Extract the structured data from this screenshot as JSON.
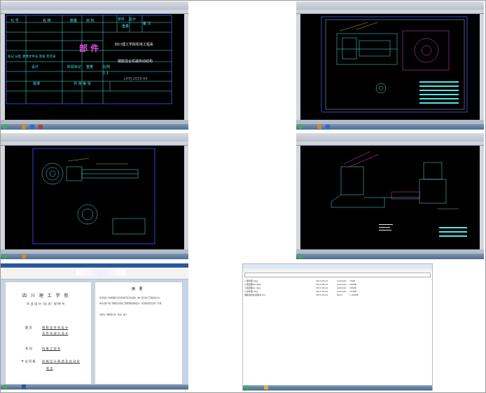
{
  "shot1": {
    "table_cells": {
      "code": "代  号",
      "name": "名  称",
      "quantity": "数量",
      "material": "材  料",
      "unit_weight": "单件",
      "total": "总计",
      "weight": "重量",
      "remark": "备  注",
      "big_title": "部  件",
      "school": "四川理工学院机电工程系",
      "drawing": "钢筋混合机械传动结构",
      "number": "LHPJ-2033-04",
      "mark": "阶段标记",
      "weight2": "重量",
      "scale": "比例",
      "scale_val": "1:1",
      "sheets": "共  张  第  张",
      "check": "批准",
      "zone": "标记  分区  更改文件号  签名  年月日",
      "design": "设计"
    }
  },
  "shot5": {
    "title": "四 川 理 工 学 院",
    "subtitle": "毕 业 设 计（论 文）说 明 书",
    "field_topic_label": "题  目",
    "field_topic_value": "钢 筋 混 合 机 设 计",
    "field_topic_value2": "及 传 动 部 分 设 计",
    "field_dept_label": "系  别",
    "field_dept_value": "机 电 工 程 系",
    "field_major_label": "专 业 班 级",
    "field_major_value": "机 械 设 计 制 造 及 自 动 化",
    "field_student": "姓 名",
    "abstract_title": "摘  要",
    "abstract_line1": "混合机是一种将钢筋与混合料进行混合的设备，被广泛应用于工程建设之中。",
    "abstract_line2": "本文主要介绍了钢筋混合机的工作原理和结构设计，对其传动部分进行了计算。",
    "abstract_line3": "关键词：钢筋混合机；传动；设计"
  },
  "shot6": {
    "files": [
      {
        "name": "1.部件图.dwg",
        "date": "2013-05-21",
        "type": "AutoCAD",
        "size": "75KB"
      },
      {
        "name": "2.装配图A0.dwg",
        "date": "2013-05-21",
        "type": "AutoCAD",
        "size": "296KB"
      },
      {
        "name": "3.装配图A1.dwg",
        "date": "2013-05-21",
        "type": "AutoCAD",
        "size": "186KB"
      },
      {
        "name": "4.零件图.dwg",
        "date": "2013-05-21",
        "type": "AutoCAD",
        "size": "124KB"
      },
      {
        "name": "钢筋混合机说明书.doc",
        "date": "2013-05-21",
        "type": "Word",
        "size": "1,430KB"
      }
    ]
  },
  "colors": {
    "cad_bg": "#000000",
    "cad_line_cyan": "#4fe8e8",
    "cad_line_magenta": "#e54ad7",
    "cad_line_blue": "#3a5cff",
    "cad_line_yellow": "#f0e030"
  }
}
